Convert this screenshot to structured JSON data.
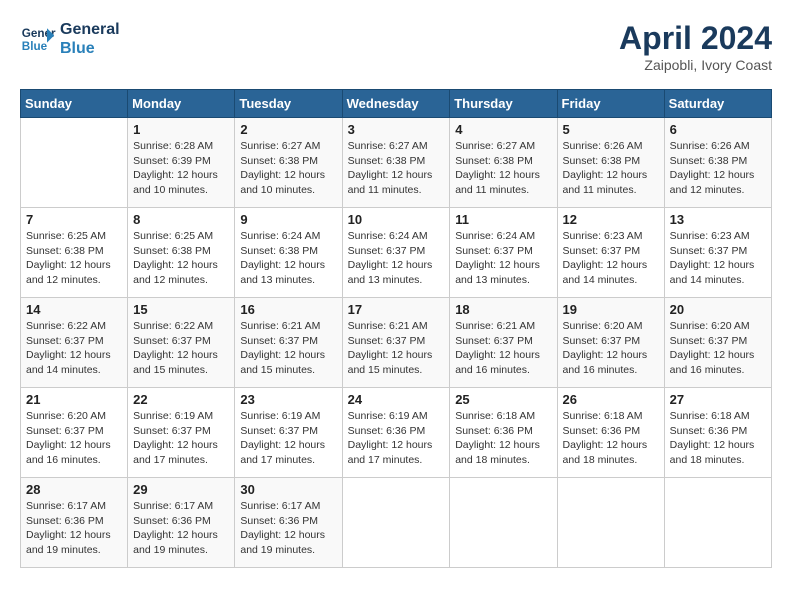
{
  "header": {
    "logo_line1": "General",
    "logo_line2": "Blue",
    "month": "April 2024",
    "location": "Zaipobli, Ivory Coast"
  },
  "weekdays": [
    "Sunday",
    "Monday",
    "Tuesday",
    "Wednesday",
    "Thursday",
    "Friday",
    "Saturday"
  ],
  "weeks": [
    [
      {
        "day": "",
        "info": ""
      },
      {
        "day": "1",
        "info": "Sunrise: 6:28 AM\nSunset: 6:39 PM\nDaylight: 12 hours\nand 10 minutes."
      },
      {
        "day": "2",
        "info": "Sunrise: 6:27 AM\nSunset: 6:38 PM\nDaylight: 12 hours\nand 10 minutes."
      },
      {
        "day": "3",
        "info": "Sunrise: 6:27 AM\nSunset: 6:38 PM\nDaylight: 12 hours\nand 11 minutes."
      },
      {
        "day": "4",
        "info": "Sunrise: 6:27 AM\nSunset: 6:38 PM\nDaylight: 12 hours\nand 11 minutes."
      },
      {
        "day": "5",
        "info": "Sunrise: 6:26 AM\nSunset: 6:38 PM\nDaylight: 12 hours\nand 11 minutes."
      },
      {
        "day": "6",
        "info": "Sunrise: 6:26 AM\nSunset: 6:38 PM\nDaylight: 12 hours\nand 12 minutes."
      }
    ],
    [
      {
        "day": "7",
        "info": "Sunrise: 6:25 AM\nSunset: 6:38 PM\nDaylight: 12 hours\nand 12 minutes."
      },
      {
        "day": "8",
        "info": "Sunrise: 6:25 AM\nSunset: 6:38 PM\nDaylight: 12 hours\nand 12 minutes."
      },
      {
        "day": "9",
        "info": "Sunrise: 6:24 AM\nSunset: 6:38 PM\nDaylight: 12 hours\nand 13 minutes."
      },
      {
        "day": "10",
        "info": "Sunrise: 6:24 AM\nSunset: 6:37 PM\nDaylight: 12 hours\nand 13 minutes."
      },
      {
        "day": "11",
        "info": "Sunrise: 6:24 AM\nSunset: 6:37 PM\nDaylight: 12 hours\nand 13 minutes."
      },
      {
        "day": "12",
        "info": "Sunrise: 6:23 AM\nSunset: 6:37 PM\nDaylight: 12 hours\nand 14 minutes."
      },
      {
        "day": "13",
        "info": "Sunrise: 6:23 AM\nSunset: 6:37 PM\nDaylight: 12 hours\nand 14 minutes."
      }
    ],
    [
      {
        "day": "14",
        "info": "Sunrise: 6:22 AM\nSunset: 6:37 PM\nDaylight: 12 hours\nand 14 minutes."
      },
      {
        "day": "15",
        "info": "Sunrise: 6:22 AM\nSunset: 6:37 PM\nDaylight: 12 hours\nand 15 minutes."
      },
      {
        "day": "16",
        "info": "Sunrise: 6:21 AM\nSunset: 6:37 PM\nDaylight: 12 hours\nand 15 minutes."
      },
      {
        "day": "17",
        "info": "Sunrise: 6:21 AM\nSunset: 6:37 PM\nDaylight: 12 hours\nand 15 minutes."
      },
      {
        "day": "18",
        "info": "Sunrise: 6:21 AM\nSunset: 6:37 PM\nDaylight: 12 hours\nand 16 minutes."
      },
      {
        "day": "19",
        "info": "Sunrise: 6:20 AM\nSunset: 6:37 PM\nDaylight: 12 hours\nand 16 minutes."
      },
      {
        "day": "20",
        "info": "Sunrise: 6:20 AM\nSunset: 6:37 PM\nDaylight: 12 hours\nand 16 minutes."
      }
    ],
    [
      {
        "day": "21",
        "info": "Sunrise: 6:20 AM\nSunset: 6:37 PM\nDaylight: 12 hours\nand 16 minutes."
      },
      {
        "day": "22",
        "info": "Sunrise: 6:19 AM\nSunset: 6:37 PM\nDaylight: 12 hours\nand 17 minutes."
      },
      {
        "day": "23",
        "info": "Sunrise: 6:19 AM\nSunset: 6:37 PM\nDaylight: 12 hours\nand 17 minutes."
      },
      {
        "day": "24",
        "info": "Sunrise: 6:19 AM\nSunset: 6:36 PM\nDaylight: 12 hours\nand 17 minutes."
      },
      {
        "day": "25",
        "info": "Sunrise: 6:18 AM\nSunset: 6:36 PM\nDaylight: 12 hours\nand 18 minutes."
      },
      {
        "day": "26",
        "info": "Sunrise: 6:18 AM\nSunset: 6:36 PM\nDaylight: 12 hours\nand 18 minutes."
      },
      {
        "day": "27",
        "info": "Sunrise: 6:18 AM\nSunset: 6:36 PM\nDaylight: 12 hours\nand 18 minutes."
      }
    ],
    [
      {
        "day": "28",
        "info": "Sunrise: 6:17 AM\nSunset: 6:36 PM\nDaylight: 12 hours\nand 19 minutes."
      },
      {
        "day": "29",
        "info": "Sunrise: 6:17 AM\nSunset: 6:36 PM\nDaylight: 12 hours\nand 19 minutes."
      },
      {
        "day": "30",
        "info": "Sunrise: 6:17 AM\nSunset: 6:36 PM\nDaylight: 12 hours\nand 19 minutes."
      },
      {
        "day": "",
        "info": ""
      },
      {
        "day": "",
        "info": ""
      },
      {
        "day": "",
        "info": ""
      },
      {
        "day": "",
        "info": ""
      }
    ]
  ]
}
